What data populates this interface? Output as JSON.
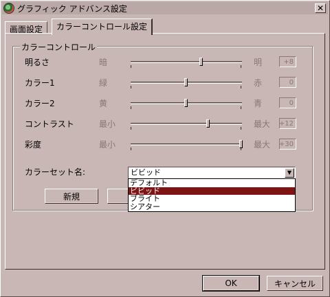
{
  "window": {
    "title": "グラフィック アドバンス設定",
    "close_glyph": "✕"
  },
  "tabs": [
    {
      "label": "画面設定"
    },
    {
      "label": "カラーコントロール設定"
    }
  ],
  "group": {
    "legend": "カラーコントロール"
  },
  "rows": [
    {
      "label": "明るさ",
      "min": "暗",
      "max": "明",
      "value": "+8"
    },
    {
      "label": "カラー1",
      "min": "緑",
      "max": "赤",
      "value": "0"
    },
    {
      "label": "カラー2",
      "min": "黄",
      "max": "青",
      "value": "0"
    },
    {
      "label": "コントラスト",
      "min": "最小",
      "max": "最大",
      "value": "+12"
    },
    {
      "label": "彩度",
      "min": "最小",
      "max": "最大",
      "value": "+30"
    }
  ],
  "sliders": {
    "levels": [
      0.64,
      0.5,
      0.5,
      0.7,
      1.0
    ]
  },
  "preset": {
    "label": "カラーセット名:",
    "selected": "ビビッド",
    "options": [
      "デフォルト",
      "ビビッド",
      "ブライト",
      "シアター"
    ],
    "highlighted_index": 1
  },
  "buttons": {
    "new": "新規",
    "ok": "OK",
    "cancel": "キャンセル"
  },
  "colors": {
    "face": "#c9b7b5",
    "highlight": "#7e1414"
  }
}
